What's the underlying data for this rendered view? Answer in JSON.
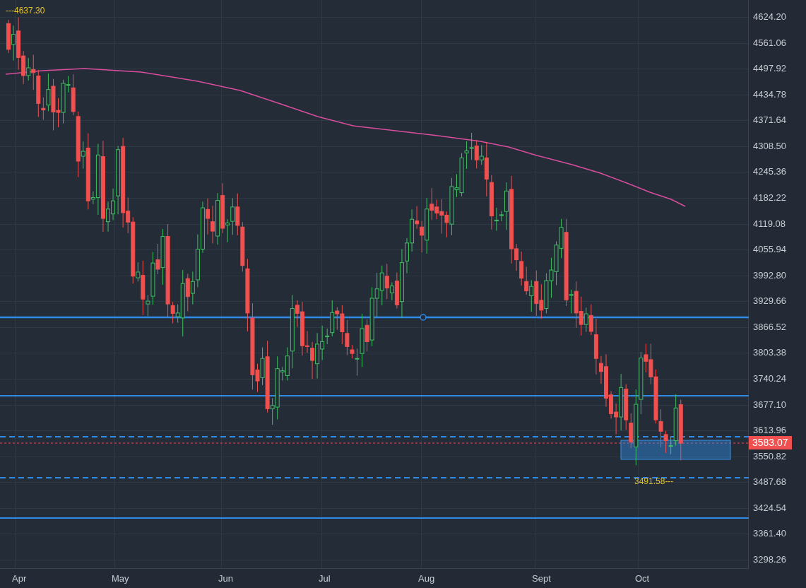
{
  "chart": {
    "high_marker": "---4637.30",
    "low_marker": "3491.58---",
    "last_price": "3583.07",
    "y_axis_labels": [
      "4624.20",
      "4561.06",
      "4497.92",
      "4434.78",
      "4371.64",
      "4308.50",
      "4245.36",
      "4182.22",
      "4119.08",
      "4055.94",
      "3992.80",
      "3929.66",
      "3866.52",
      "3803.38",
      "3740.24",
      "3677.10",
      "3613.96",
      "3550.82",
      "3487.68",
      "3424.54",
      "3361.40",
      "3298.26"
    ],
    "x_axis_labels": [
      "Apr",
      "May",
      "Jun",
      "Jul",
      "Aug",
      "Sept",
      "Oct"
    ]
  }
}
